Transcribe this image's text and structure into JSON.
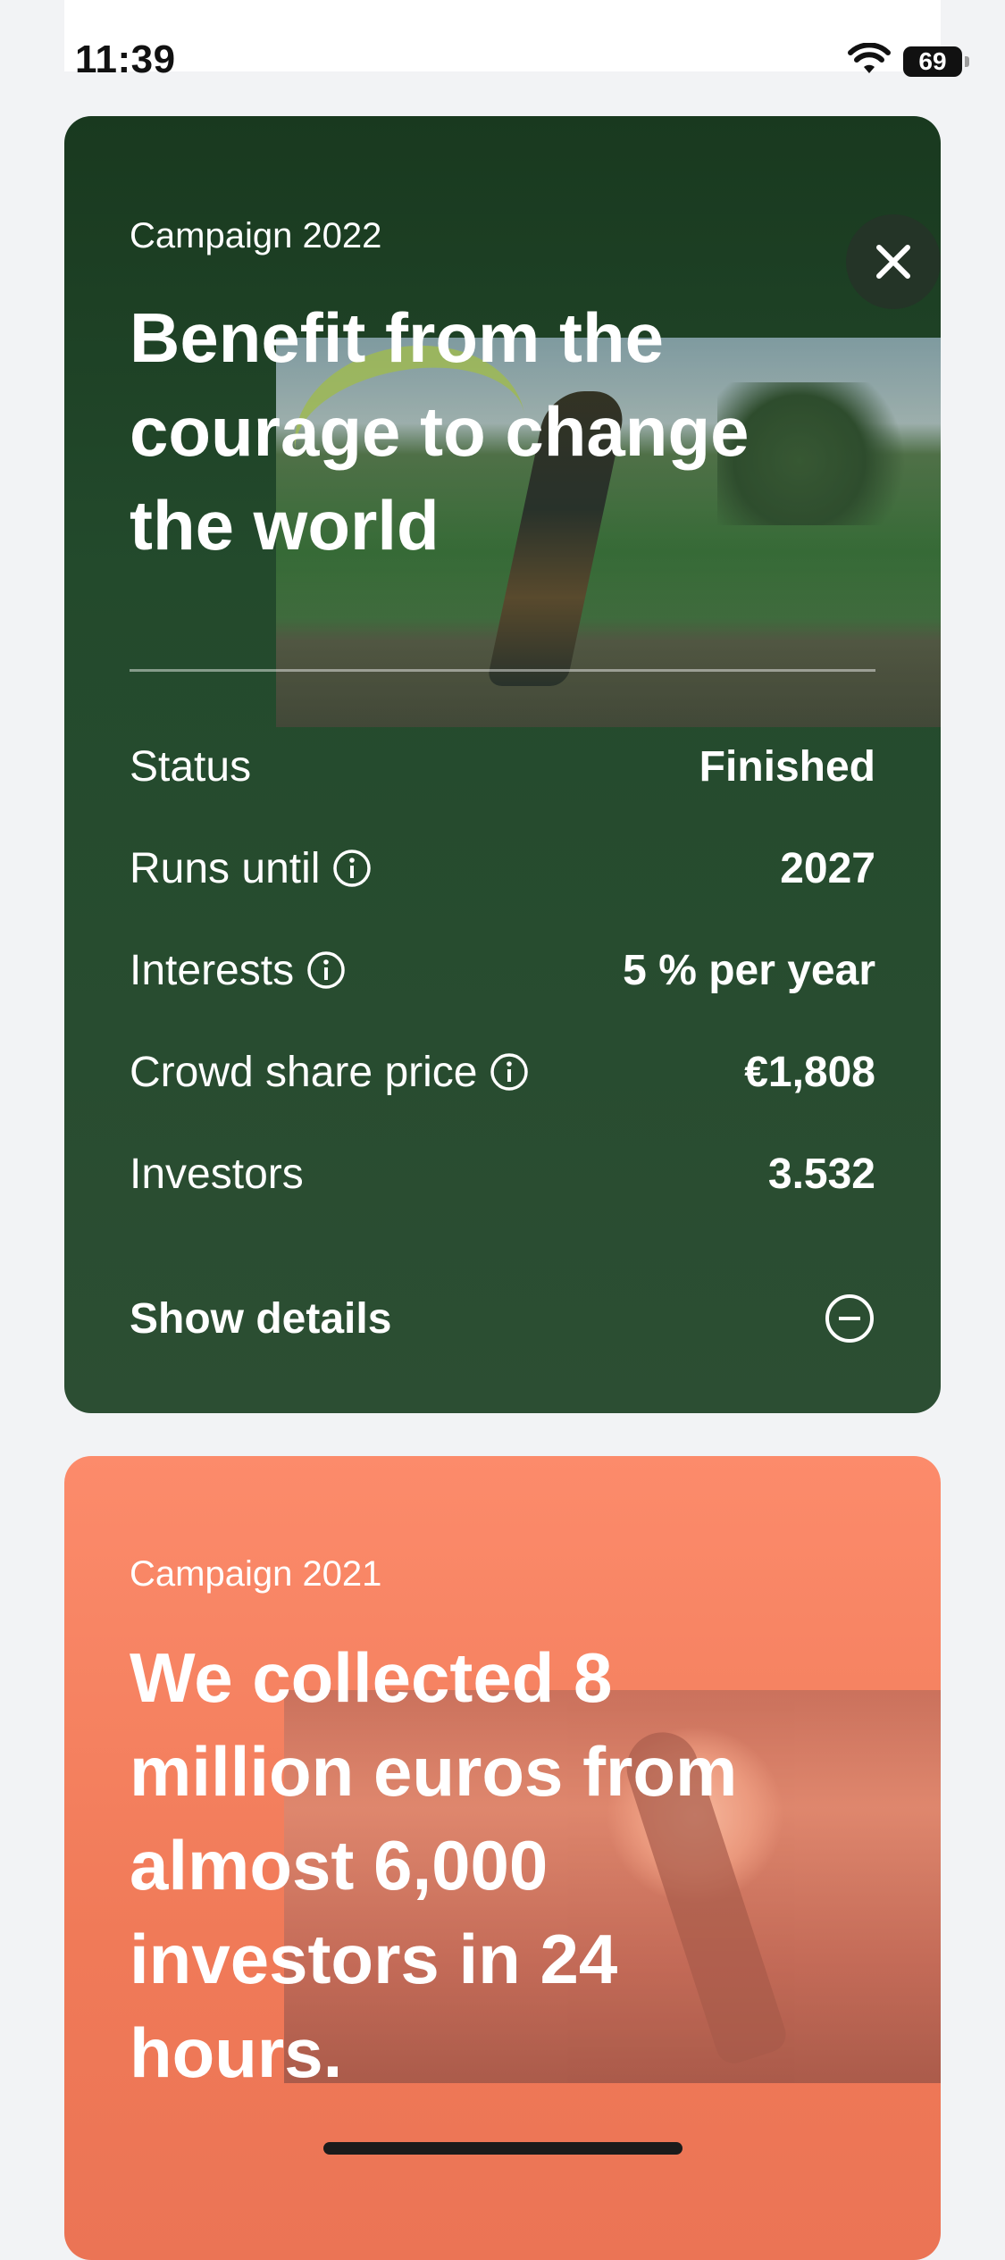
{
  "status_bar": {
    "time": "11:39",
    "battery": "69"
  },
  "campaign_2022": {
    "eyebrow": "Campaign 2022",
    "headline": "Benefit from the courage to change the world",
    "rows": [
      {
        "label": "Status",
        "value": "Finished"
      },
      {
        "label": "Runs until",
        "value": "2027"
      },
      {
        "label": "Interests",
        "value": "5 % per year"
      },
      {
        "label": "Crowd share price",
        "value": "€1,808"
      },
      {
        "label": "Investors",
        "value": "3.532"
      }
    ],
    "details_label": "Show details"
  },
  "campaign_2021": {
    "eyebrow": "Campaign 2021",
    "headline": "We collected 8 million euros from almost 6,000 investors in 24 hours."
  },
  "icons": {
    "close": "close-icon",
    "info": "info-icon",
    "collapse": "minus-circle-icon",
    "wifi": "wifi-icon",
    "battery": "battery-icon"
  },
  "colors": {
    "green_card": "#234a2c",
    "orange_card": "#f07a58",
    "background": "#f2f3f5"
  }
}
